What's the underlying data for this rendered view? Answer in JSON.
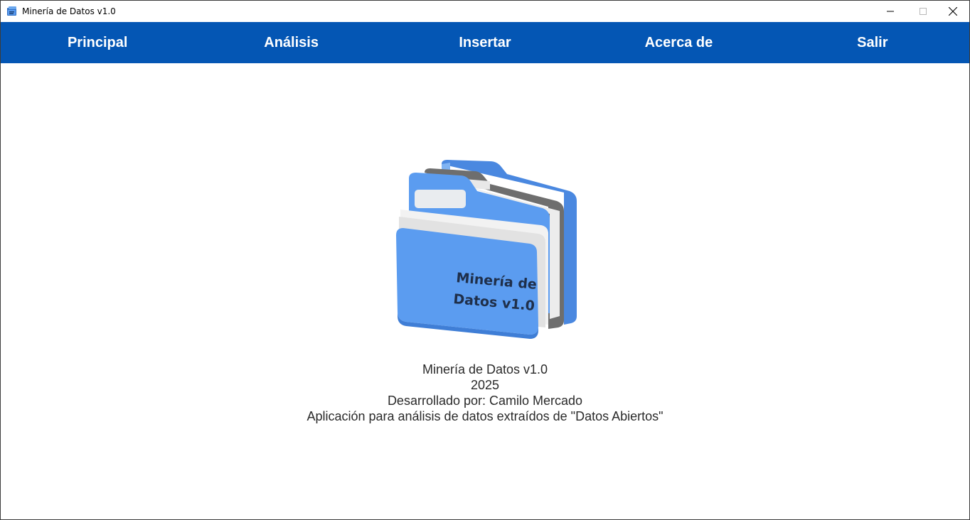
{
  "window": {
    "title": "Minería de Datos v1.0",
    "controls": {
      "minimize": "—",
      "maximize": "☐",
      "close": "✕"
    }
  },
  "menu": {
    "items": [
      {
        "label": "Principal"
      },
      {
        "label": "Análisis"
      },
      {
        "label": "Insertar"
      },
      {
        "label": "Acerca de"
      },
      {
        "label": "Salir"
      }
    ]
  },
  "logo": {
    "line1": "Minería de",
    "line2": "Datos v1.0",
    "icon": "folders-icon"
  },
  "about": {
    "app_name": "Minería de Datos v1.0",
    "year": "2025",
    "developer": "Desarrollado por: Camilo Mercado",
    "description": "Aplicación para análisis de datos extraídos de \"Datos Abiertos\""
  },
  "colors": {
    "menubar": "#0456b4",
    "folder_front": "#5b9cf0",
    "folder_back": "#4a88e0",
    "folder_middle": "#6e6e6e"
  }
}
